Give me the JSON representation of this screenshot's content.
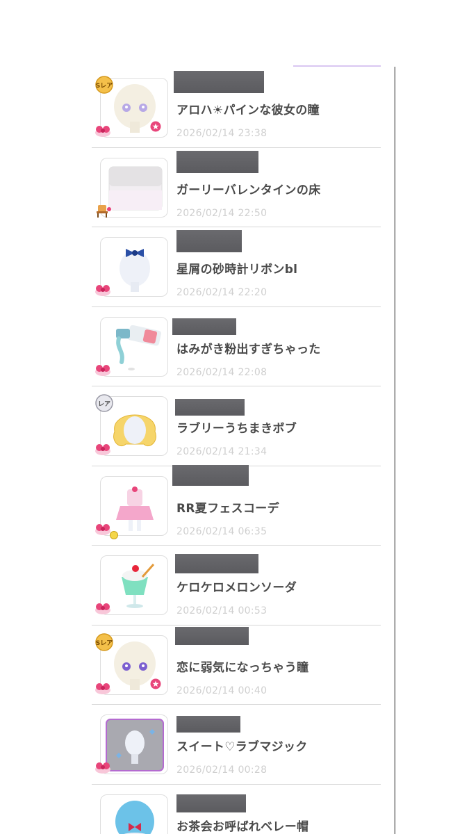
{
  "items": [
    {
      "title": "アロハ☀パインな彼女の瞳",
      "date": "2026/02/14 23:38",
      "rarity": "Sレア",
      "icon": "eye-item"
    },
    {
      "title": "ガーリーバレンタインの床",
      "date": "2026/02/14 22:50",
      "rarity": "",
      "icon": "floor-item"
    },
    {
      "title": "星屑の砂時計リボンbl",
      "date": "2026/02/14 22:20",
      "rarity": "",
      "icon": "ribbon-item"
    },
    {
      "title": "はみがき粉出すぎちゃった",
      "date": "2026/02/14 22:08",
      "rarity": "",
      "icon": "toothpaste-item"
    },
    {
      "title": "ラブリーうちまきボブ",
      "date": "2026/02/14 21:34",
      "rarity": "レア",
      "icon": "hair-item"
    },
    {
      "title": "RR夏フェスコーデ",
      "date": "2026/02/14 06:35",
      "rarity": "",
      "icon": "outfit-item"
    },
    {
      "title": "ケロケロメロンソーダ",
      "date": "2026/02/14 00:53",
      "rarity": "",
      "icon": "soda-item"
    },
    {
      "title": "恋に弱気になっちゃう瞳",
      "date": "2026/02/14 00:40",
      "rarity": "Sレア",
      "icon": "eye-item"
    },
    {
      "title": "スイート♡ラブマジック",
      "date": "2026/02/14 00:28",
      "rarity": "",
      "icon": "magic-item"
    },
    {
      "title": "お茶会お呼ばれベレー帽",
      "date": "",
      "rarity": "",
      "icon": "beret-item"
    }
  ],
  "colors": {
    "title": "#4a4a4a",
    "date": "#cfcfcf",
    "gift": "#e8457a",
    "accent": "#d9c7f2"
  }
}
